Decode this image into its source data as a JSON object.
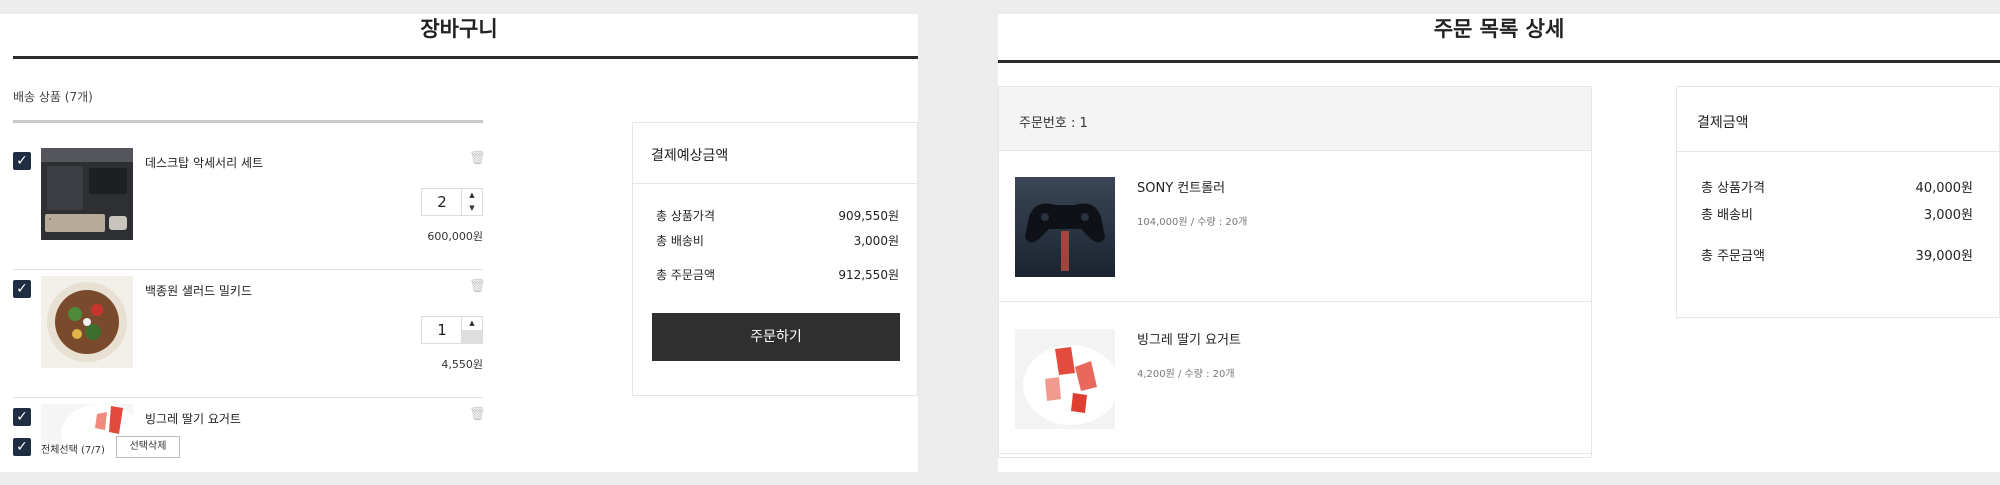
{
  "cart": {
    "title": "장바구니",
    "section_label": "배송 상품 (7개)",
    "items": [
      {
        "name": "데스크탑 악세서리 세트",
        "quantity": "2",
        "price": "600,000원"
      },
      {
        "name": "백종원 샐러드 밀키드",
        "quantity": "1",
        "price": "4,550원"
      },
      {
        "name": "빙그레 딸기 요거트"
      }
    ],
    "select_all_label": "전체선택 (7/7)",
    "delete_selected_label": "선택삭제",
    "check_mark": "✓",
    "trash_glyph": "🗑",
    "stepper_up": "▲",
    "stepper_down": "▼",
    "summary": {
      "title": "결제예상금액",
      "product_total_label": "총 상품가격",
      "product_total": "909,550원",
      "shipping_label": "총 배송비",
      "shipping": "3,000원",
      "order_total_label": "총 주문금액",
      "order_total": "912,550원",
      "order_button": "주문하기"
    }
  },
  "order_detail": {
    "title": "주문 목록 상세",
    "order_number": "주문번호 : 1",
    "items": [
      {
        "name": "SONY 컨트롤러",
        "meta": "104,000원 / 수량 : 20개"
      },
      {
        "name": "빙그레 딸기 요거트",
        "meta": "4,200원 / 수량 : 20개"
      }
    ],
    "payment": {
      "title": "결제금액",
      "product_total_label": "총 상품가격",
      "product_total": "40,000원",
      "shipping_label": "총 배송비",
      "shipping": "3,000원",
      "order_total_label": "총 주문금액",
      "order_total": "39,000원"
    }
  },
  "colors": {
    "checkbox": "#1f2d42",
    "order_button": "#2f2f2f",
    "title_rule": "#2b2b2b"
  },
  "icons": [
    "check-icon",
    "trash-icon",
    "chevron-up-icon",
    "chevron-down-icon"
  ]
}
